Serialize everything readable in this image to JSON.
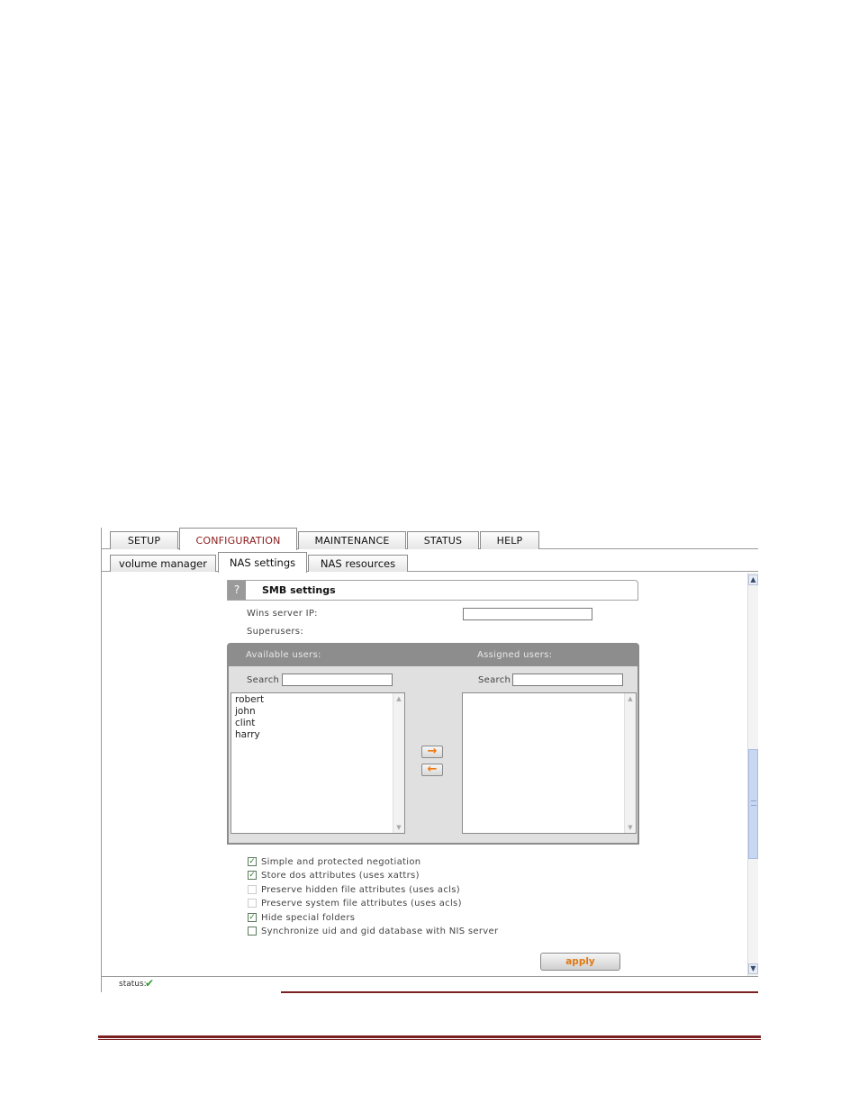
{
  "main_tabs": [
    {
      "label": "SETUP",
      "active": false
    },
    {
      "label": "CONFIGURATION",
      "active": true
    },
    {
      "label": "MAINTENANCE",
      "active": false
    },
    {
      "label": "STATUS",
      "active": false
    },
    {
      "label": "HELP",
      "active": false
    }
  ],
  "sub_tabs": [
    {
      "label": "volume manager",
      "active": false
    },
    {
      "label": "NAS settings",
      "active": true
    },
    {
      "label": "NAS resources",
      "active": false
    }
  ],
  "section": {
    "help": "?",
    "title": "SMB settings"
  },
  "wins": {
    "label": "Wins server IP:",
    "value": ""
  },
  "superusers_label": "Superusers:",
  "available": {
    "header": "Available users:",
    "search_label": "Search",
    "search_value": "",
    "users": [
      "robert",
      "john",
      "clint",
      "harry"
    ]
  },
  "assigned": {
    "header": "Assigned users:",
    "search_label": "Search",
    "search_value": "",
    "users": []
  },
  "arrows": {
    "add": "→",
    "remove": "←"
  },
  "options": [
    {
      "label": "Simple and protected negotiation",
      "checked": true,
      "enabled": true
    },
    {
      "label": "Store dos attributes (uses xattrs)",
      "checked": true,
      "enabled": true
    },
    {
      "label": "Preserve hidden file attributes (uses acls)",
      "checked": false,
      "enabled": false
    },
    {
      "label": "Preserve system file attributes (uses acls)",
      "checked": false,
      "enabled": false
    },
    {
      "label": "Hide special folders",
      "checked": true,
      "enabled": true
    },
    {
      "label": "Synchronize uid and gid database with NIS server",
      "checked": false,
      "enabled": true
    }
  ],
  "apply_label": "apply",
  "status": {
    "label": "status:",
    "icon": "✔"
  },
  "colors": {
    "accent_red": "#8a1a1a",
    "apply_orange": "#e07810",
    "status_green": "#2e9a2e"
  }
}
